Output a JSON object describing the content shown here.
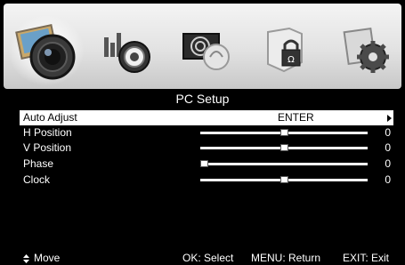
{
  "menu_icons": [
    {
      "name": "picture-icon",
      "selected": true
    },
    {
      "name": "sound-icon",
      "selected": false
    },
    {
      "name": "channel-icon",
      "selected": false
    },
    {
      "name": "lock-icon",
      "selected": false
    },
    {
      "name": "settings-icon",
      "selected": false
    }
  ],
  "title": "PC Setup",
  "items": [
    {
      "label": "Auto Adjust",
      "value": "ENTER",
      "selected": true
    },
    {
      "label": "H Position",
      "value": "0",
      "level": 0.5
    },
    {
      "label": "V Position",
      "value": "0",
      "level": 0.5
    },
    {
      "label": "Phase",
      "value": "0",
      "level": 0.0
    },
    {
      "label": "Clock",
      "value": "0",
      "level": 0.5
    }
  ],
  "footer": {
    "move": "Move",
    "select": "OK: Select",
    "return": "MENU: Return",
    "exit": "EXIT: Exit"
  },
  "colors": {
    "background": "#000000",
    "selected_row": "#ffffff",
    "bar_top": "#f4f4f4",
    "bar_bottom": "#c8c8c8"
  }
}
